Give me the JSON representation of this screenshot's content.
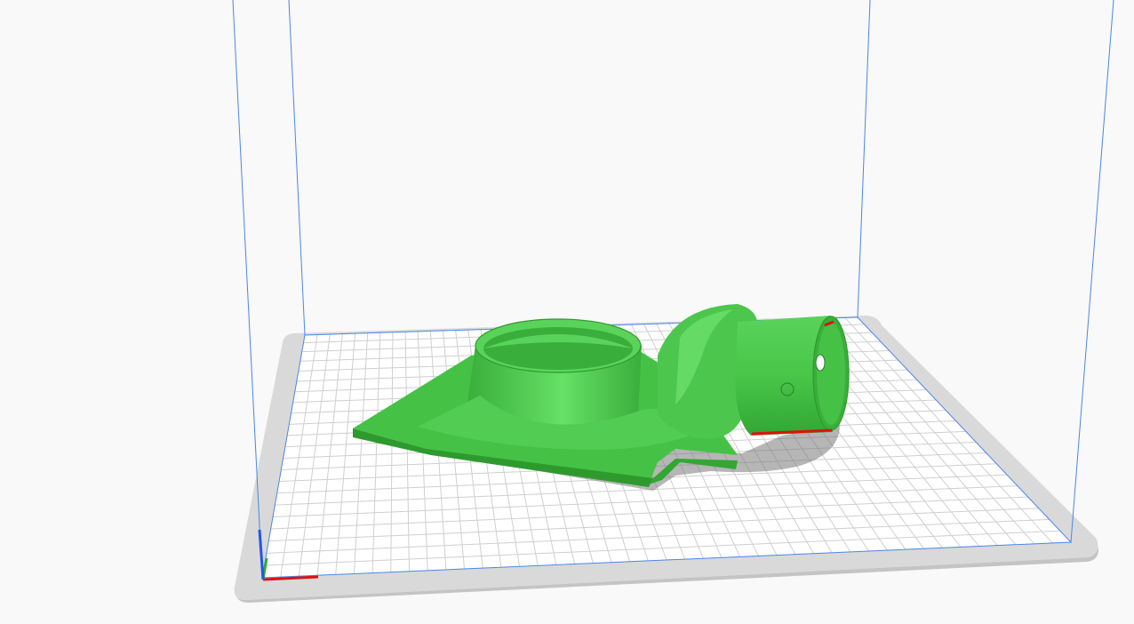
{
  "viewport": {
    "background_color": "#f9f9f9",
    "build_plate_color": "#d9d9d9",
    "build_plate_surface_color": "#ffffff",
    "grid_color": "#cfcfcf",
    "build_volume_edge_color": "#4a86e8",
    "model_color": "#45c245",
    "model_highlight_color": "#62dd62",
    "model_shadow_color": "#2e9a2e",
    "overhang_color": "#e01010",
    "plate_shadow_color": "#7a7a7a"
  },
  "axes": {
    "x_color": "#e01010",
    "y_color": "#33aa33",
    "z_color": "#2255ee"
  },
  "icons": {
    "origin": "axis-origin-icon"
  }
}
